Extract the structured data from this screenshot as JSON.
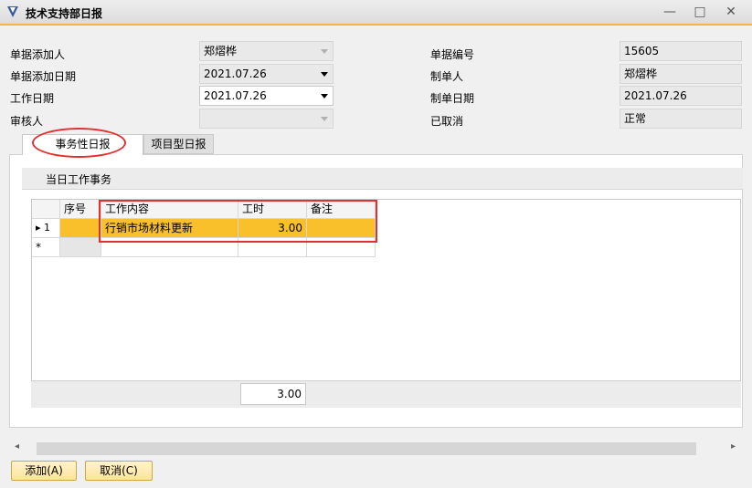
{
  "window": {
    "title": "技术支持部日报",
    "minimize": "—",
    "maximize": "□",
    "close": "✕"
  },
  "form": {
    "adder_label": "单据添加人",
    "adder_value": "郑熠桦",
    "add_date_label": "单据添加日期",
    "add_date_value": "2021.07.26",
    "work_date_label": "工作日期",
    "work_date_value": "2021.07.26",
    "reviewer_label": "审核人",
    "reviewer_value": "",
    "doc_no_label": "单据编号",
    "doc_no_value": "15605",
    "maker_label": "制单人",
    "maker_value": "郑熠桦",
    "make_date_label": "制单日期",
    "make_date_value": "2021.07.26",
    "cancelled_label": "已取消",
    "cancelled_value": "正常"
  },
  "tabs": [
    {
      "label": "事务性日报"
    },
    {
      "label": "项目型日报"
    }
  ],
  "group_title": "当日工作事务",
  "grid": {
    "columns": [
      "序号",
      "工作内容",
      "工时",
      "备注"
    ],
    "rows": [
      {
        "index_marker": "▸ 1",
        "content": "行销市场材料更新",
        "hours": "3.00",
        "note": ""
      }
    ],
    "new_row_marker": "*",
    "total_hours": "3.00"
  },
  "buttons": {
    "add": "添加(A)",
    "cancel": "取消(C)"
  }
}
